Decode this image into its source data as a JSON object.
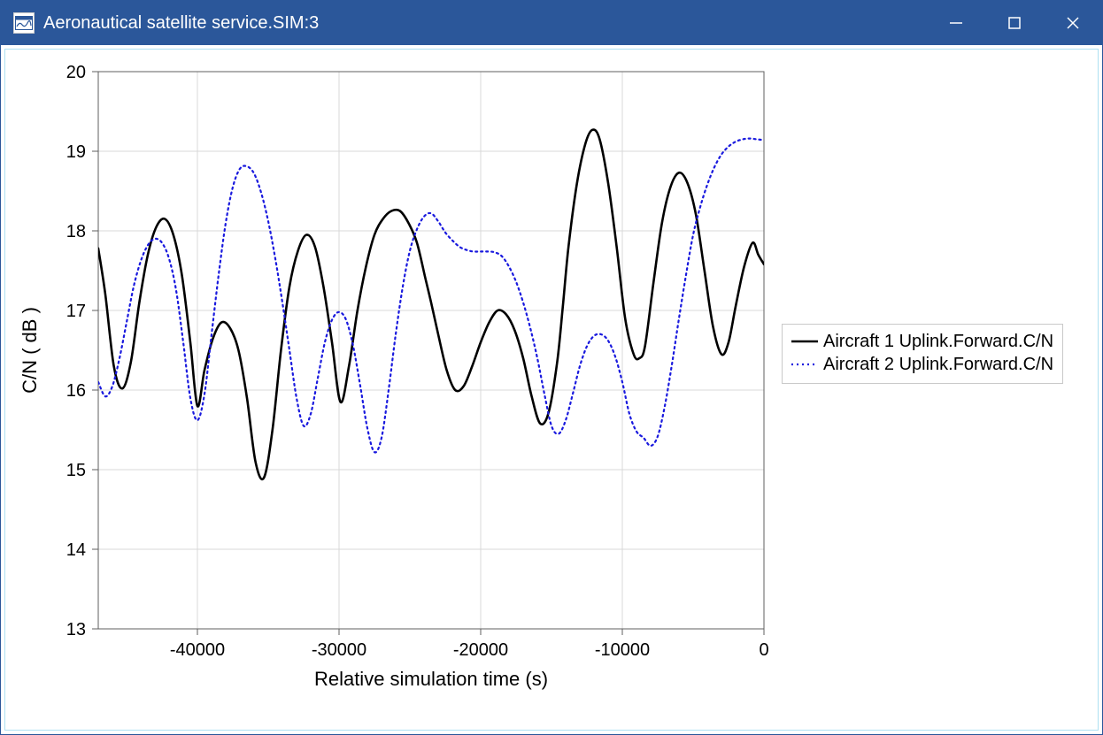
{
  "window": {
    "title": "Aeronautical satellite service.SIM:3"
  },
  "chart_data": {
    "type": "line",
    "xlabel": "Relative simulation time (s)",
    "ylabel": "C/N ( dB )",
    "xlim": [
      -47000,
      0
    ],
    "ylim": [
      13,
      20
    ],
    "x_ticks": [
      -40000,
      -30000,
      -20000,
      -10000,
      0
    ],
    "y_ticks": [
      13,
      14,
      15,
      16,
      17,
      18,
      19,
      20
    ],
    "legend_position": "right",
    "series": [
      {
        "name": "Aircraft 1 Uplink.Forward.C/N",
        "color": "#000000",
        "style": "solid",
        "x": [
          -47000,
          -46500,
          -45900,
          -45300,
          -44700,
          -44100,
          -43500,
          -42900,
          -42300,
          -41700,
          -41100,
          -40500,
          -40000,
          -39500,
          -38900,
          -38300,
          -37700,
          -37100,
          -36500,
          -35900,
          -35300,
          -34700,
          -34100,
          -33500,
          -32900,
          -32300,
          -31700,
          -31100,
          -30500,
          -29900,
          -29300,
          -28700,
          -28100,
          -27500,
          -26900,
          -26300,
          -25700,
          -25100,
          -24500,
          -23900,
          -23500,
          -23000,
          -22400,
          -21800,
          -21200,
          -20600,
          -20000,
          -19400,
          -18800,
          -18200,
          -17600,
          -17000,
          -16400,
          -15800,
          -15200,
          -14600,
          -14200,
          -13800,
          -13200,
          -12600,
          -12100,
          -11600,
          -11000,
          -10400,
          -9800,
          -9200,
          -8800,
          -8400,
          -7800,
          -7200,
          -6600,
          -6000,
          -5400,
          -4800,
          -4200,
          -3600,
          -3000,
          -2500,
          -2000,
          -1400,
          -800,
          -400,
          0
        ],
        "values": [
          17.78,
          17.2,
          16.3,
          16.02,
          16.35,
          17.1,
          17.7,
          18.05,
          18.15,
          17.95,
          17.45,
          16.6,
          15.8,
          16.25,
          16.65,
          16.85,
          16.78,
          16.5,
          15.9,
          15.1,
          14.9,
          15.5,
          16.5,
          17.3,
          17.75,
          17.95,
          17.8,
          17.3,
          16.6,
          15.85,
          16.3,
          17.0,
          17.55,
          17.95,
          18.15,
          18.25,
          18.25,
          18.1,
          17.85,
          17.4,
          17.1,
          16.7,
          16.25,
          16.0,
          16.05,
          16.3,
          16.6,
          16.85,
          17.0,
          16.95,
          16.75,
          16.4,
          15.92,
          15.58,
          15.72,
          16.35,
          17.05,
          17.8,
          18.6,
          19.1,
          19.27,
          19.15,
          18.6,
          17.8,
          16.9,
          16.45,
          16.4,
          16.55,
          17.35,
          18.1,
          18.55,
          18.73,
          18.6,
          18.2,
          17.5,
          16.8,
          16.45,
          16.6,
          17.05,
          17.55,
          17.85,
          17.7,
          17.58
        ]
      },
      {
        "name": "Aircraft 2 Uplink.Forward.C/N",
        "color": "#1a1ade",
        "style": "dotted",
        "x": [
          -47000,
          -46500,
          -46000,
          -45500,
          -45000,
          -44500,
          -44000,
          -43500,
          -43000,
          -42500,
          -42000,
          -41500,
          -41000,
          -40500,
          -40000,
          -39500,
          -39000,
          -38500,
          -38000,
          -37500,
          -37000,
          -36500,
          -36000,
          -35500,
          -35000,
          -34500,
          -34000,
          -33500,
          -33000,
          -32500,
          -32000,
          -31500,
          -31000,
          -30500,
          -30000,
          -29500,
          -29000,
          -28500,
          -28000,
          -27500,
          -27000,
          -26500,
          -26000,
          -25500,
          -25000,
          -24500,
          -24000,
          -23500,
          -23000,
          -22500,
          -22000,
          -21500,
          -21000,
          -20500,
          -20000,
          -19500,
          -19000,
          -18500,
          -18000,
          -17500,
          -17000,
          -16500,
          -16000,
          -15500,
          -15000,
          -14500,
          -14000,
          -13500,
          -13000,
          -12500,
          -12000,
          -11500,
          -11000,
          -10500,
          -10000,
          -9500,
          -9000,
          -8500,
          -8000,
          -7500,
          -7000,
          -6500,
          -6000,
          -5500,
          -5000,
          -4500,
          -4000,
          -3500,
          -3000,
          -2500,
          -2000,
          -1500,
          -1000,
          -500,
          0
        ],
        "values": [
          16.1,
          15.92,
          16.05,
          16.4,
          16.85,
          17.3,
          17.62,
          17.82,
          17.9,
          17.85,
          17.65,
          17.25,
          16.6,
          15.9,
          15.62,
          15.95,
          16.7,
          17.45,
          18.1,
          18.55,
          18.78,
          18.81,
          18.72,
          18.48,
          18.12,
          17.65,
          17.1,
          16.5,
          15.9,
          15.55,
          15.7,
          16.15,
          16.6,
          16.88,
          16.98,
          16.88,
          16.55,
          16.05,
          15.52,
          15.22,
          15.4,
          16.0,
          16.7,
          17.3,
          17.75,
          18.02,
          18.18,
          18.22,
          18.12,
          17.98,
          17.88,
          17.8,
          17.76,
          17.74,
          17.74,
          17.74,
          17.73,
          17.68,
          17.55,
          17.36,
          17.1,
          16.78,
          16.4,
          15.95,
          15.55,
          15.45,
          15.62,
          15.95,
          16.3,
          16.55,
          16.68,
          16.7,
          16.62,
          16.42,
          16.1,
          15.7,
          15.48,
          15.4,
          15.3,
          15.42,
          15.8,
          16.32,
          16.9,
          17.45,
          17.95,
          18.3,
          18.58,
          18.8,
          18.96,
          19.06,
          19.12,
          19.15,
          19.16,
          19.15,
          19.14
        ]
      }
    ]
  }
}
